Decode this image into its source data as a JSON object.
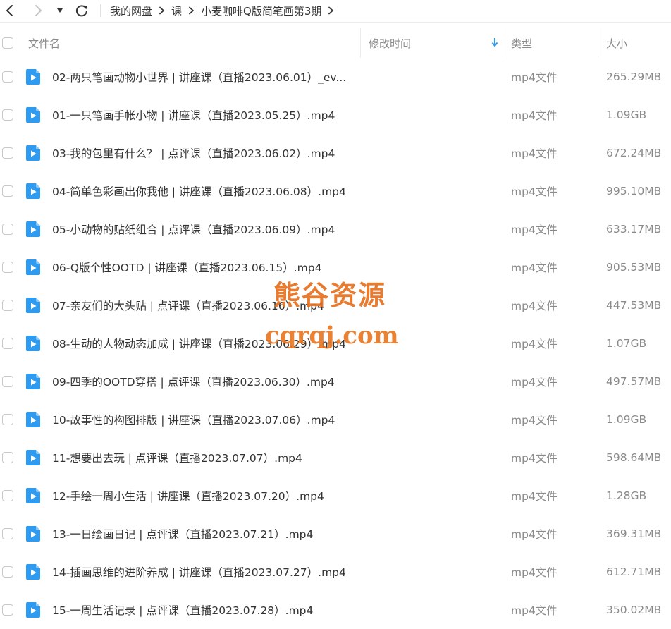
{
  "toolbar": {
    "back_icon": "chevron-left-icon",
    "forward_icon": "chevron-right-icon",
    "history_dropdown_icon": "caret-down-icon",
    "refresh_icon": "refresh-icon",
    "separator_icon": "chevron-right-icon"
  },
  "breadcrumb": [
    "我的网盘",
    "课",
    "小麦咖啡Q版简笔画第3期"
  ],
  "columns": {
    "name": "文件名",
    "modified": "修改时间",
    "type": "类型",
    "size": "大小",
    "sort_icon": "sort-down-arrow-icon"
  },
  "files": [
    {
      "name": "02-两只笔画动物小世界 | 讲座课（直播2023.06.01）_ev...",
      "modified": "",
      "type": "mp4文件",
      "size": "265.29MB",
      "icon": "video-file-icon"
    },
    {
      "name": "01-一只笔画手帐小物 | 讲座课（直播2023.05.25）.mp4",
      "modified": "",
      "type": "mp4文件",
      "size": "1.09GB",
      "icon": "video-file-icon"
    },
    {
      "name": "03-我的包里有什么？ | 点评课（直播2023.06.02）.mp4",
      "modified": "",
      "type": "mp4文件",
      "size": "672.24MB",
      "icon": "video-file-icon"
    },
    {
      "name": "04-简单色彩画出你我他 | 讲座课（直播2023.06.08）.mp4",
      "modified": "",
      "type": "mp4文件",
      "size": "995.10MB",
      "icon": "video-file-icon"
    },
    {
      "name": "05-小动物的贴纸组合 | 点评课（直播2023.06.09）.mp4",
      "modified": "",
      "type": "mp4文件",
      "size": "633.17MB",
      "icon": "video-file-icon"
    },
    {
      "name": "06-Q版个性OOTD | 讲座课（直播2023.06.15）.mp4",
      "modified": "",
      "type": "mp4文件",
      "size": "905.53MB",
      "icon": "video-file-icon"
    },
    {
      "name": "07-亲友们的大头贴 | 点评课（直播2023.06.16）.mp4",
      "modified": "",
      "type": "mp4文件",
      "size": "447.53MB",
      "icon": "video-file-icon"
    },
    {
      "name": "08-生动的人物动态加成 | 讲座课（直播2023.06.29）.mp4",
      "modified": "",
      "type": "mp4文件",
      "size": "1.07GB",
      "icon": "video-file-icon"
    },
    {
      "name": "09-四季的OOTD穿搭 | 点评课（直播2023.06.30）.mp4",
      "modified": "",
      "type": "mp4文件",
      "size": "497.57MB",
      "icon": "video-file-icon"
    },
    {
      "name": "10-故事性的构图排版 | 讲座课（直播2023.07.06）.mp4",
      "modified": "",
      "type": "mp4文件",
      "size": "1.09GB",
      "icon": "video-file-icon"
    },
    {
      "name": "11-想要出去玩 | 点评课（直播2023.07.07）.mp4",
      "modified": "",
      "type": "mp4文件",
      "size": "598.64MB",
      "icon": "video-file-icon"
    },
    {
      "name": "12-手绘一周小生活 | 讲座课（直播2023.07.20）.mp4",
      "modified": "",
      "type": "mp4文件",
      "size": "1.28GB",
      "icon": "video-file-icon"
    },
    {
      "name": "13-一日绘画日记 | 点评课（直播2023.07.21）.mp4",
      "modified": "",
      "type": "mp4文件",
      "size": "369.31MB",
      "icon": "video-file-icon"
    },
    {
      "name": "14-插画思维的进阶养成 | 讲座课（直播2023.07.27）.mp4",
      "modified": "",
      "type": "mp4文件",
      "size": "612.71MB",
      "icon": "video-file-icon"
    },
    {
      "name": "15-一周生活记录 | 点评课（直播2023.07.28）.mp4",
      "modified": "",
      "type": "mp4文件",
      "size": "350.02MB",
      "icon": "video-file-icon"
    }
  ],
  "watermark": {
    "line1": "熊谷资源",
    "line2": "cqrqj.com"
  },
  "colors": {
    "file_icon": "#2f9bf0",
    "watermark": "#e6701e",
    "text_primary": "#333333",
    "text_secondary": "#8a8a8a",
    "sort_arrow": "#2f9bf0"
  }
}
